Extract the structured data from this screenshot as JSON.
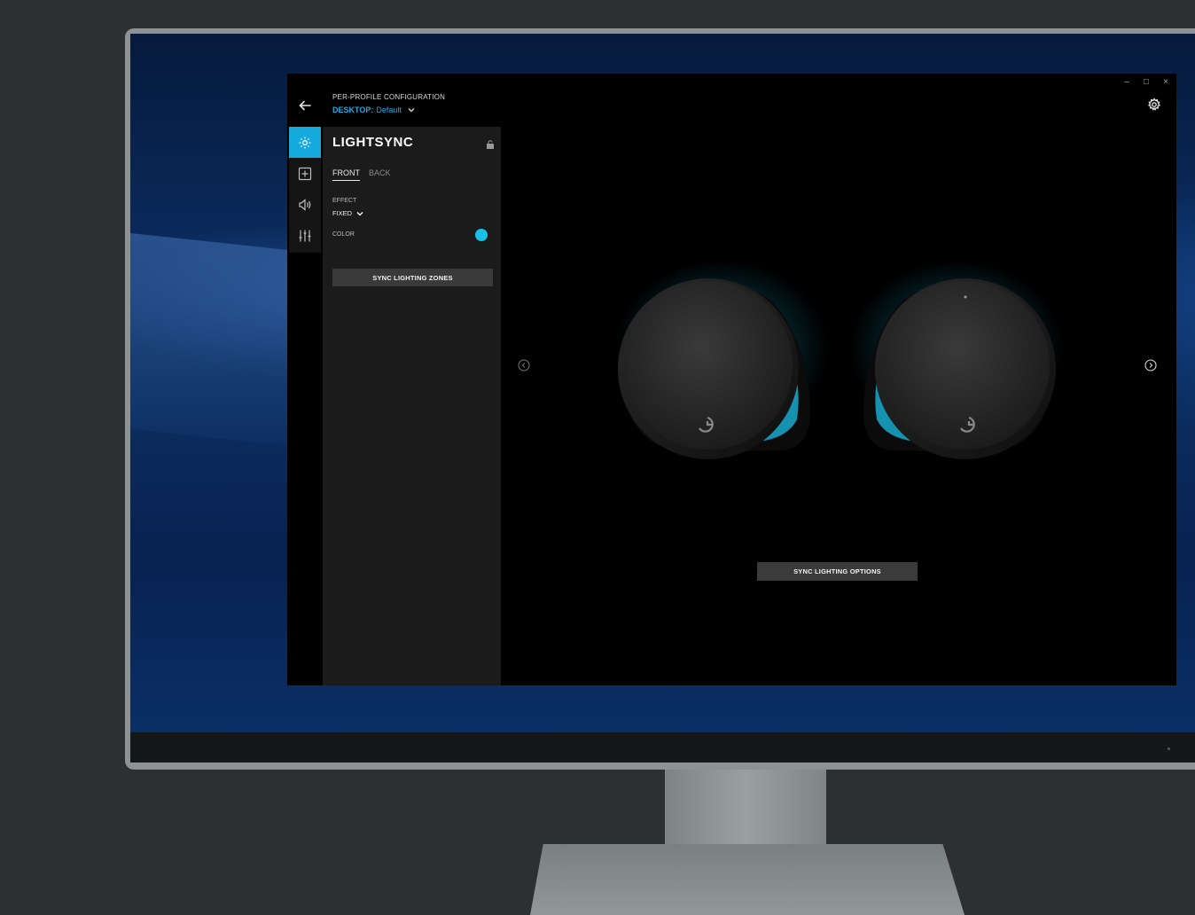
{
  "header": {
    "title": "PER-PROFILE CONFIGURATION",
    "profile_prefix": "DESKTOP:",
    "profile_name": "Default"
  },
  "window_controls": {
    "minimize": "–",
    "maximize": "□",
    "close": "×"
  },
  "sidebar": {
    "items": [
      {
        "icon": "lightsync-sun-icon",
        "active": true
      },
      {
        "icon": "add-assignment-icon",
        "active": false
      },
      {
        "icon": "speaker-audio-icon",
        "active": false
      },
      {
        "icon": "equalizer-sliders-icon",
        "active": false
      }
    ]
  },
  "panel": {
    "title": "LIGHTSYNC",
    "tabs": [
      {
        "label": "FRONT",
        "active": true
      },
      {
        "label": "BACK",
        "active": false
      }
    ],
    "effect_label": "EFFECT",
    "effect_value": "FIXED",
    "color_label": "COLOR",
    "color_value": "#19c0e8",
    "sync_zones_label": "SYNC LIGHTING ZONES"
  },
  "stage": {
    "sync_options_label": "SYNC LIGHTING OPTIONS",
    "device": "speakers"
  },
  "colors": {
    "accent": "#15a9dd",
    "glow": "#19c0e8",
    "panel_bg": "#1b1b1b",
    "app_bg": "#000000"
  }
}
